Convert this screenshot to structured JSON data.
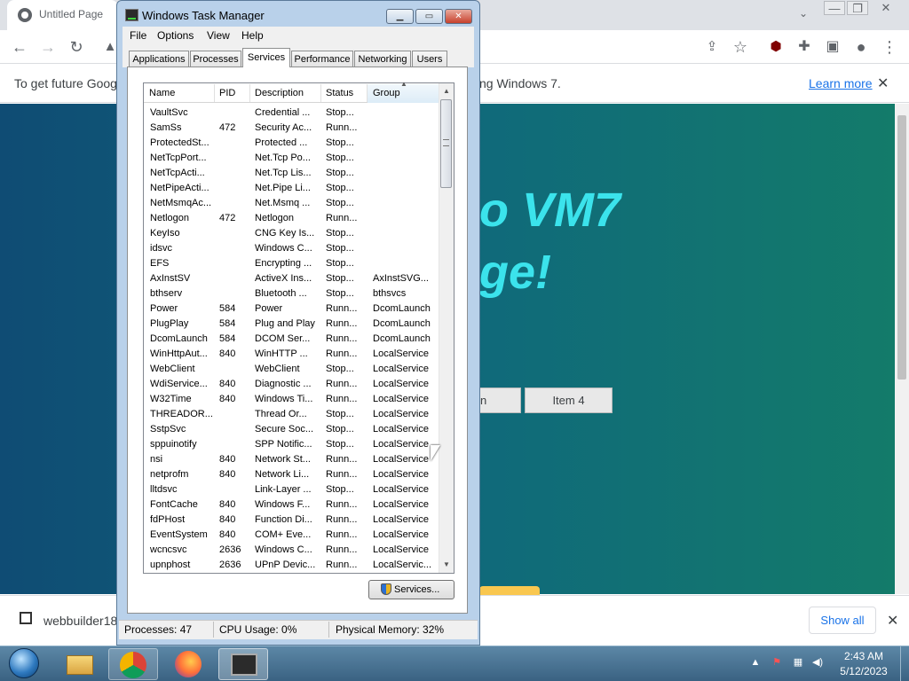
{
  "browser": {
    "tab_title": "Untitled Page",
    "tab_list_icon": "chevron-down-icon",
    "window_controls": [
      "—",
      "❐",
      "✕"
    ],
    "infobar": {
      "text": "To get future Google",
      "text_tail": "ng Windows 7.",
      "learn_more": "Learn more",
      "close_icon": "✕"
    },
    "page": {
      "hero_line1": "o VM7",
      "hero_line2": "ge!",
      "button_partial": "n",
      "button_item4": "Item 4"
    },
    "downloads": {
      "file_name": "webbuilder18x",
      "show_all": "Show all",
      "close_icon": "✕"
    }
  },
  "task_manager": {
    "title": "Windows Task Manager",
    "menu": [
      "File",
      "Options",
      "View",
      "Help"
    ],
    "tabs": [
      "Applications",
      "Processes",
      "Services",
      "Performance",
      "Networking",
      "Users"
    ],
    "active_tab": "Services",
    "columns": [
      "Name",
      "PID",
      "Description",
      "Status",
      "Group"
    ],
    "services": [
      [
        "VaultSvc",
        "",
        "Credential ...",
        "Stop...",
        ""
      ],
      [
        "SamSs",
        "472",
        "Security Ac...",
        "Runn...",
        ""
      ],
      [
        "ProtectedSt...",
        "",
        "Protected ...",
        "Stop...",
        ""
      ],
      [
        "NetTcpPort...",
        "",
        "Net.Tcp Po...",
        "Stop...",
        ""
      ],
      [
        "NetTcpActi...",
        "",
        "Net.Tcp Lis...",
        "Stop...",
        ""
      ],
      [
        "NetPipeActi...",
        "",
        "Net.Pipe Li...",
        "Stop...",
        ""
      ],
      [
        "NetMsmqAc...",
        "",
        "Net.Msmq ...",
        "Stop...",
        ""
      ],
      [
        "Netlogon",
        "472",
        "Netlogon",
        "Runn...",
        ""
      ],
      [
        "KeyIso",
        "",
        "CNG Key Is...",
        "Stop...",
        ""
      ],
      [
        "idsvc",
        "",
        "Windows C...",
        "Stop...",
        ""
      ],
      [
        "EFS",
        "",
        "Encrypting ...",
        "Stop...",
        ""
      ],
      [
        "AxInstSV",
        "",
        "ActiveX Ins...",
        "Stop...",
        "AxInstSVG..."
      ],
      [
        "bthserv",
        "",
        "Bluetooth ...",
        "Stop...",
        "bthsvcs"
      ],
      [
        "Power",
        "584",
        "Power",
        "Runn...",
        "DcomLaunch"
      ],
      [
        "PlugPlay",
        "584",
        "Plug and Play",
        "Runn...",
        "DcomLaunch"
      ],
      [
        "DcomLaunch",
        "584",
        "DCOM Ser...",
        "Runn...",
        "DcomLaunch"
      ],
      [
        "WinHttpAut...",
        "840",
        "WinHTTP ...",
        "Runn...",
        "LocalService"
      ],
      [
        "WebClient",
        "",
        "WebClient",
        "Stop...",
        "LocalService"
      ],
      [
        "WdiService...",
        "840",
        "Diagnostic ...",
        "Runn...",
        "LocalService"
      ],
      [
        "W32Time",
        "840",
        "Windows Ti...",
        "Runn...",
        "LocalService"
      ],
      [
        "THREADOR...",
        "",
        "Thread Or...",
        "Stop...",
        "LocalService"
      ],
      [
        "SstpSvc",
        "",
        "Secure Soc...",
        "Stop...",
        "LocalService"
      ],
      [
        "sppuinotify",
        "",
        "SPP Notific...",
        "Stop...",
        "LocalService"
      ],
      [
        "nsi",
        "840",
        "Network St...",
        "Runn...",
        "LocalService"
      ],
      [
        "netprofm",
        "840",
        "Network Li...",
        "Runn...",
        "LocalService"
      ],
      [
        "lltdsvc",
        "",
        "Link-Layer ...",
        "Stop...",
        "LocalService"
      ],
      [
        "FontCache",
        "840",
        "Windows F...",
        "Runn...",
        "LocalService"
      ],
      [
        "fdPHost",
        "840",
        "Function Di...",
        "Runn...",
        "LocalService"
      ],
      [
        "EventSystem",
        "840",
        "COM+ Eve...",
        "Runn...",
        "LocalService"
      ],
      [
        "wcncsvc",
        "2636",
        "Windows C...",
        "Runn...",
        "LocalService"
      ],
      [
        "upnphost",
        "2636",
        "UPnP Devic...",
        "Runn...",
        "LocalServic..."
      ]
    ],
    "services_button": "Services...",
    "status_bar": {
      "processes": "Processes: 47",
      "cpu": "CPU Usage: 0%",
      "memory": "Physical Memory: 32%"
    }
  },
  "taskbar": {
    "time": "2:43 AM",
    "date": "5/12/2023"
  },
  "colors": {
    "page_gradient_start": "#0f4c74",
    "page_gradient_end": "#137b6a",
    "hero_text": "#3be3ec",
    "link": "#1a73e8"
  }
}
